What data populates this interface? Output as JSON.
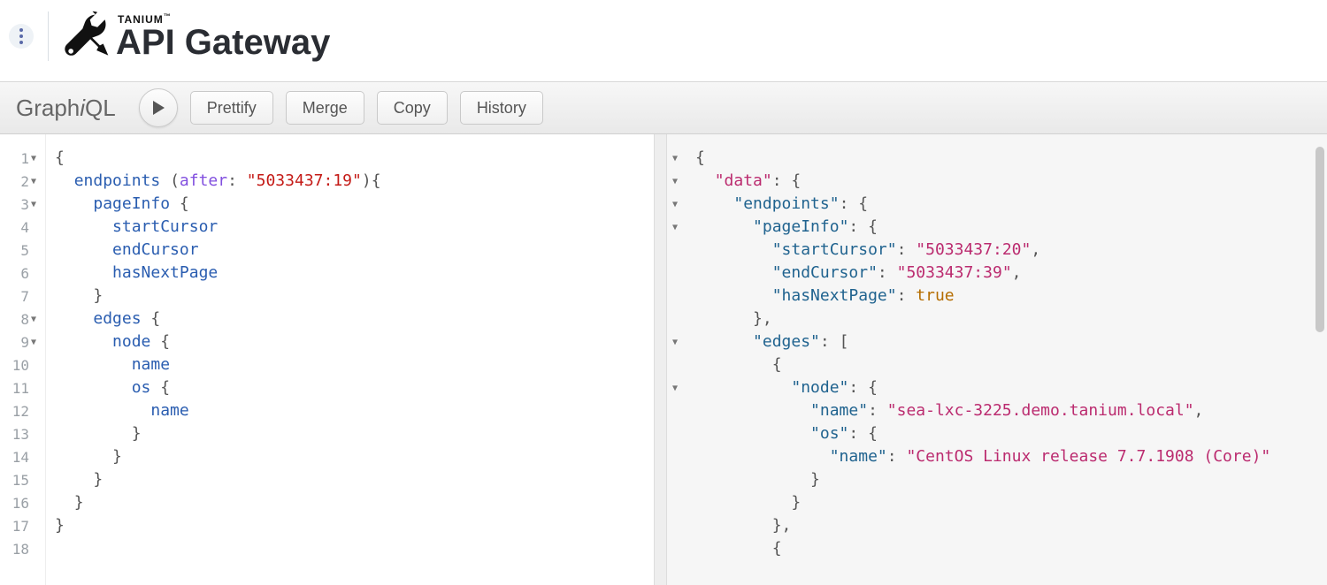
{
  "header": {
    "company": "TANIUM",
    "tm": "™",
    "product": "API Gateway"
  },
  "toolbar": {
    "logo_prefix": "Graph",
    "logo_i": "i",
    "logo_suffix": "QL",
    "prettify": "Prettify",
    "merge": "Merge",
    "copy": "Copy",
    "history": "History"
  },
  "query": {
    "lines": [
      {
        "num": "1",
        "fold": true
      },
      {
        "num": "2",
        "fold": true
      },
      {
        "num": "3",
        "fold": true
      },
      {
        "num": "4",
        "fold": false
      },
      {
        "num": "5",
        "fold": false
      },
      {
        "num": "6",
        "fold": false
      },
      {
        "num": "7",
        "fold": false
      },
      {
        "num": "8",
        "fold": true
      },
      {
        "num": "9",
        "fold": true
      },
      {
        "num": "10",
        "fold": false
      },
      {
        "num": "11",
        "fold": false
      },
      {
        "num": "12",
        "fold": false
      },
      {
        "num": "13",
        "fold": false
      },
      {
        "num": "14",
        "fold": false
      },
      {
        "num": "15",
        "fold": false
      },
      {
        "num": "16",
        "fold": false
      },
      {
        "num": "17",
        "fold": false
      },
      {
        "num": "18",
        "fold": false
      }
    ],
    "brace_open": "{",
    "brace_close": "}",
    "paren_open": "(",
    "paren_close": ")",
    "endpoints": "endpoints",
    "after_arg": "after",
    "after_val": "\"5033437:19\"",
    "pageInfo": "pageInfo",
    "startCursor": "startCursor",
    "endCursor": "endCursor",
    "hasNextPage": "hasNextPage",
    "edges": "edges",
    "node": "node",
    "name": "name",
    "os": "os",
    "colon": ":"
  },
  "result": {
    "folds": [
      true,
      true,
      true,
      true,
      false,
      false,
      false,
      false,
      true,
      false,
      true,
      false,
      false,
      false,
      false,
      false,
      false,
      false
    ],
    "k_data": "\"data\"",
    "k_endpoints": "\"endpoints\"",
    "k_pageInfo": "\"pageInfo\"",
    "k_startCursor": "\"startCursor\"",
    "v_startCursor": "\"5033437:20\"",
    "k_endCursor": "\"endCursor\"",
    "v_endCursor": "\"5033437:39\"",
    "k_hasNextPage": "\"hasNextPage\"",
    "v_hasNextPage": "true",
    "k_edges": "\"edges\"",
    "k_node": "\"node\"",
    "k_name": "\"name\"",
    "v_name": "\"sea-lxc-3225.demo.tanium.local\"",
    "k_os": "\"os\"",
    "v_osname": "\"CentOS Linux release 7.7.1908 (Core)\"",
    "brace_open": "{",
    "brace_close": "}",
    "bracket_open": "[",
    "comma": ",",
    "colon": ":"
  }
}
